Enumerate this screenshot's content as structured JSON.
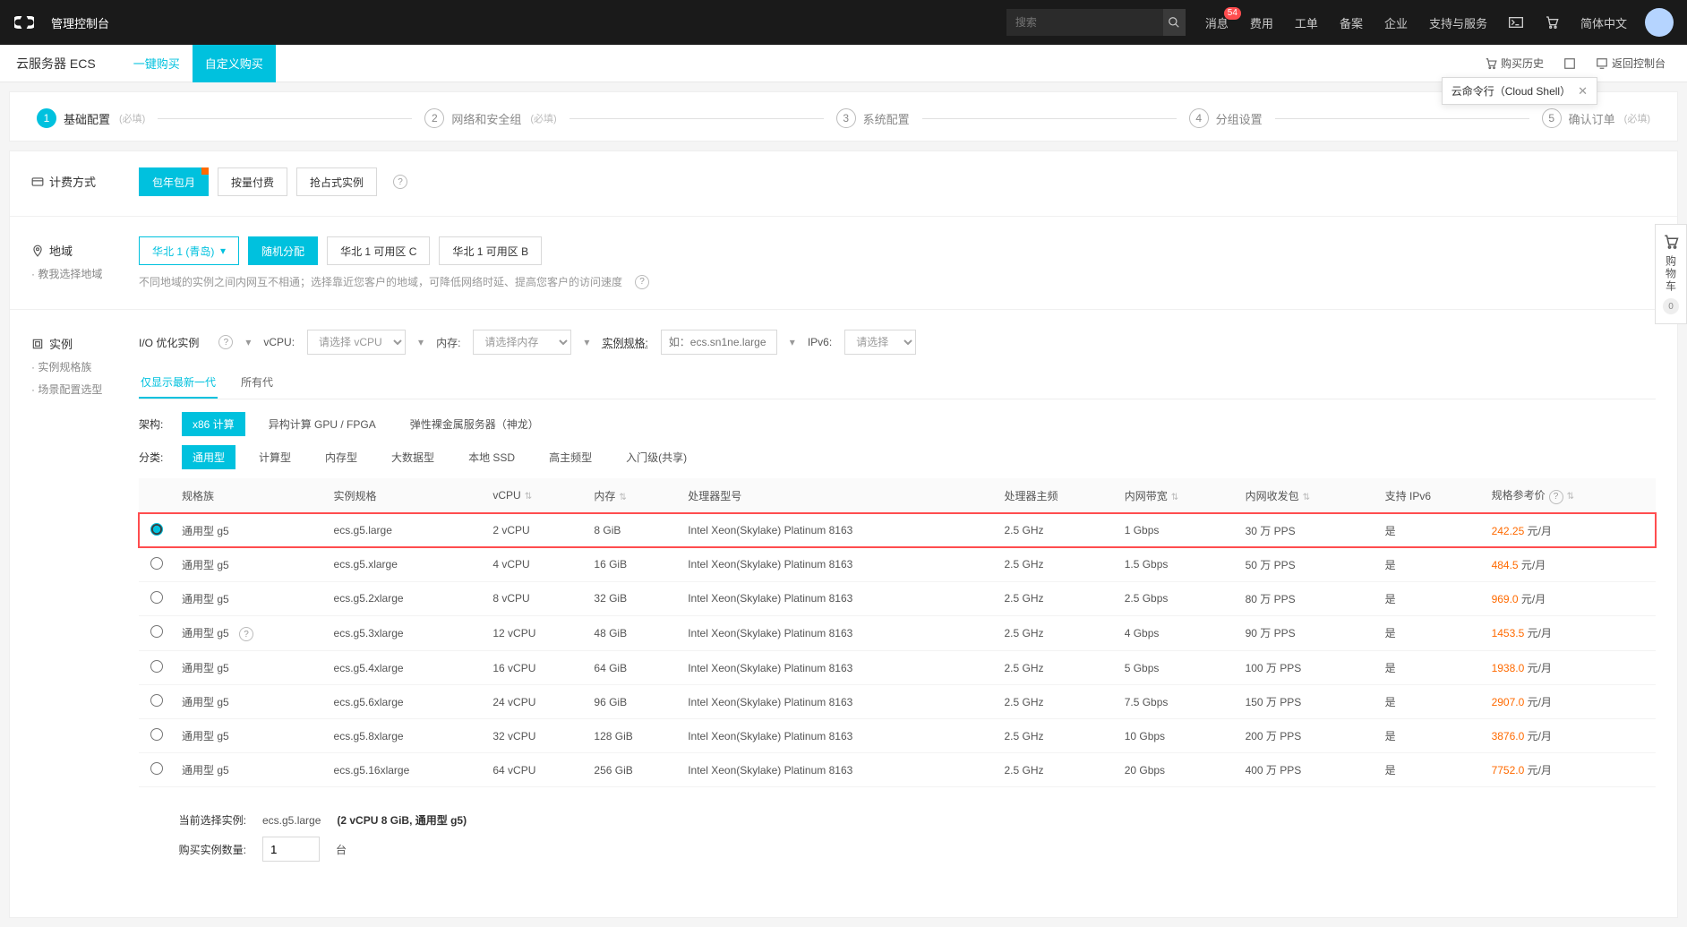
{
  "topbar": {
    "console": "管理控制台",
    "search_placeholder": "搜索",
    "nav": [
      "消息",
      "费用",
      "工单",
      "备案",
      "企业",
      "支持与服务"
    ],
    "badge": "54",
    "lang": "简体中文"
  },
  "subhead": {
    "product": "云服务器 ECS",
    "tab1": "一键购买",
    "tab2": "自定义购买",
    "history": "购买历史",
    "return": "返回控制台",
    "tooltip": "云命令行（Cloud Shell）"
  },
  "steps": [
    {
      "num": "1",
      "title": "基础配置",
      "req": "(必填)"
    },
    {
      "num": "2",
      "title": "网络和安全组",
      "req": "(必填)"
    },
    {
      "num": "3",
      "title": "系统配置",
      "req": ""
    },
    {
      "num": "4",
      "title": "分组设置",
      "req": ""
    },
    {
      "num": "5",
      "title": "确认订单",
      "req": "(必填)"
    }
  ],
  "billing": {
    "label": "计费方式",
    "options": [
      "包年包月",
      "按量付费",
      "抢占式实例"
    ]
  },
  "region": {
    "label": "地域",
    "help": "教我选择地域",
    "selected": "华北 1 (青岛)",
    "options": [
      "随机分配",
      "华北 1 可用区 C",
      "华北 1 可用区 B"
    ],
    "hint": "不同地域的实例之间内网互不相通；选择靠近您客户的地域，可降低网络时延、提高您客户的访问速度"
  },
  "instance": {
    "label": "实例",
    "sub1": "实例规格族",
    "sub2": "场景配置选型",
    "filters": {
      "io_label": "I/O 优化实例",
      "vcpu_label": "vCPU:",
      "vcpu_ph": "请选择 vCPU",
      "mem_label": "内存:",
      "mem_ph": "请选择内存",
      "spec_label": "实例规格:",
      "spec_ph": "如：ecs.sn1ne.large",
      "ipv6_label": "IPv6:",
      "ipv6_ph": "请选择"
    },
    "subtabs": [
      "仅显示最新一代",
      "所有代"
    ],
    "arch": {
      "label": "架构:",
      "items": [
        "x86 计算",
        "异构计算 GPU / FPGA",
        "弹性裸金属服务器（神龙）"
      ]
    },
    "category": {
      "label": "分类:",
      "items": [
        "通用型",
        "计算型",
        "内存型",
        "大数据型",
        "本地 SSD",
        "高主频型",
        "入门级(共享)"
      ]
    }
  },
  "table": {
    "headers": [
      "规格族",
      "实例规格",
      "vCPU",
      "内存",
      "处理器型号",
      "处理器主频",
      "内网带宽",
      "内网收发包",
      "支持 IPv6",
      "规格参考价"
    ],
    "rows": [
      {
        "family": "通用型 g5",
        "spec": "ecs.g5.large",
        "vcpu": "2 vCPU",
        "mem": "8 GiB",
        "cpu": "Intel Xeon(Skylake) Platinum 8163",
        "freq": "2.5 GHz",
        "bw": "1 Gbps",
        "pps": "30 万 PPS",
        "ipv6": "是",
        "price": "242.25",
        "unit": " 元/月",
        "selected": true
      },
      {
        "family": "通用型 g5",
        "spec": "ecs.g5.xlarge",
        "vcpu": "4 vCPU",
        "mem": "16 GiB",
        "cpu": "Intel Xeon(Skylake) Platinum 8163",
        "freq": "2.5 GHz",
        "bw": "1.5 Gbps",
        "pps": "50 万 PPS",
        "ipv6": "是",
        "price": "484.5",
        "unit": " 元/月"
      },
      {
        "family": "通用型 g5",
        "spec": "ecs.g5.2xlarge",
        "vcpu": "8 vCPU",
        "mem": "32 GiB",
        "cpu": "Intel Xeon(Skylake) Platinum 8163",
        "freq": "2.5 GHz",
        "bw": "2.5 Gbps",
        "pps": "80 万 PPS",
        "ipv6": "是",
        "price": "969.0",
        "unit": " 元/月"
      },
      {
        "family": "通用型 g5",
        "spec": "ecs.g5.3xlarge",
        "vcpu": "12 vCPU",
        "mem": "48 GiB",
        "cpu": "Intel Xeon(Skylake) Platinum 8163",
        "freq": "2.5 GHz",
        "bw": "4 Gbps",
        "pps": "90 万 PPS",
        "ipv6": "是",
        "price": "1453.5",
        "unit": " 元/月",
        "q": true
      },
      {
        "family": "通用型 g5",
        "spec": "ecs.g5.4xlarge",
        "vcpu": "16 vCPU",
        "mem": "64 GiB",
        "cpu": "Intel Xeon(Skylake) Platinum 8163",
        "freq": "2.5 GHz",
        "bw": "5 Gbps",
        "pps": "100 万 PPS",
        "ipv6": "是",
        "price": "1938.0",
        "unit": " 元/月"
      },
      {
        "family": "通用型 g5",
        "spec": "ecs.g5.6xlarge",
        "vcpu": "24 vCPU",
        "mem": "96 GiB",
        "cpu": "Intel Xeon(Skylake) Platinum 8163",
        "freq": "2.5 GHz",
        "bw": "7.5 Gbps",
        "pps": "150 万 PPS",
        "ipv6": "是",
        "price": "2907.0",
        "unit": " 元/月"
      },
      {
        "family": "通用型 g5",
        "spec": "ecs.g5.8xlarge",
        "vcpu": "32 vCPU",
        "mem": "128 GiB",
        "cpu": "Intel Xeon(Skylake) Platinum 8163",
        "freq": "2.5 GHz",
        "bw": "10 Gbps",
        "pps": "200 万 PPS",
        "ipv6": "是",
        "price": "3876.0",
        "unit": " 元/月"
      },
      {
        "family": "通用型 g5",
        "spec": "ecs.g5.16xlarge",
        "vcpu": "64 vCPU",
        "mem": "256 GiB",
        "cpu": "Intel Xeon(Skylake) Platinum 8163",
        "freq": "2.5 GHz",
        "bw": "20 Gbps",
        "pps": "400 万 PPS",
        "ipv6": "是",
        "price": "7752.0",
        "unit": " 元/月"
      }
    ]
  },
  "summary": {
    "sel_label": "当前选择实例:",
    "sel_spec": "ecs.g5.large",
    "sel_desc": "(2 vCPU 8 GiB, 通用型 g5)",
    "qty_label": "购买实例数量:",
    "qty_value": "1",
    "qty_unit": "台"
  },
  "cart": {
    "label": "购物车",
    "count": "0"
  }
}
